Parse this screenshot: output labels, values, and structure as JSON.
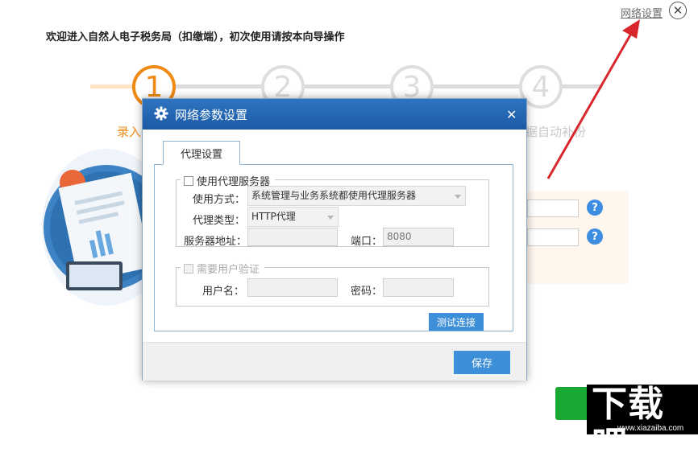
{
  "wizard": {
    "welcome": "欢迎进入自然人电子税务局（扣缴端），初次使用请按本向导操作",
    "network_link": "网络设置",
    "steps": [
      {
        "number": "1",
        "label": "录入"
      },
      {
        "number": "2",
        "label": ""
      },
      {
        "number": "3",
        "label": ""
      },
      {
        "number": "4",
        "label": "据自动补份"
      }
    ],
    "help_symbol": "?"
  },
  "dialog": {
    "title": "网络参数设置",
    "close_symbol": "✕",
    "tab_label": "代理设置",
    "proxy_group": {
      "checkbox_label": "使用代理服务器",
      "usage_label": "使用方式：",
      "usage_value": "系统管理与业务系统都使用代理服务器",
      "type_label": "代理类型：",
      "type_value": "HTTP代理",
      "address_label": "服务器地址：",
      "address_value": "",
      "port_label": "端口：",
      "port_value": "8080"
    },
    "auth_group": {
      "checkbox_label": "需要用户验证",
      "username_label": "用户名：",
      "username_value": "",
      "password_label": "密码：",
      "password_value": ""
    },
    "test_button": "测试连接",
    "save_button": "保存"
  },
  "watermark": {
    "text": "下载吧",
    "url": "www.xiazaiba.com"
  },
  "colors": {
    "accent_orange": "#f08a14",
    "dialog_header": "#2e74c0",
    "button_blue": "#3e8fd9",
    "annotation_arrow": "#d9262c",
    "next_green": "#1aa935"
  },
  "icons": {
    "dialog_icon": "gear-icon",
    "close_main": "close-circle-icon",
    "help": "question-icon"
  }
}
